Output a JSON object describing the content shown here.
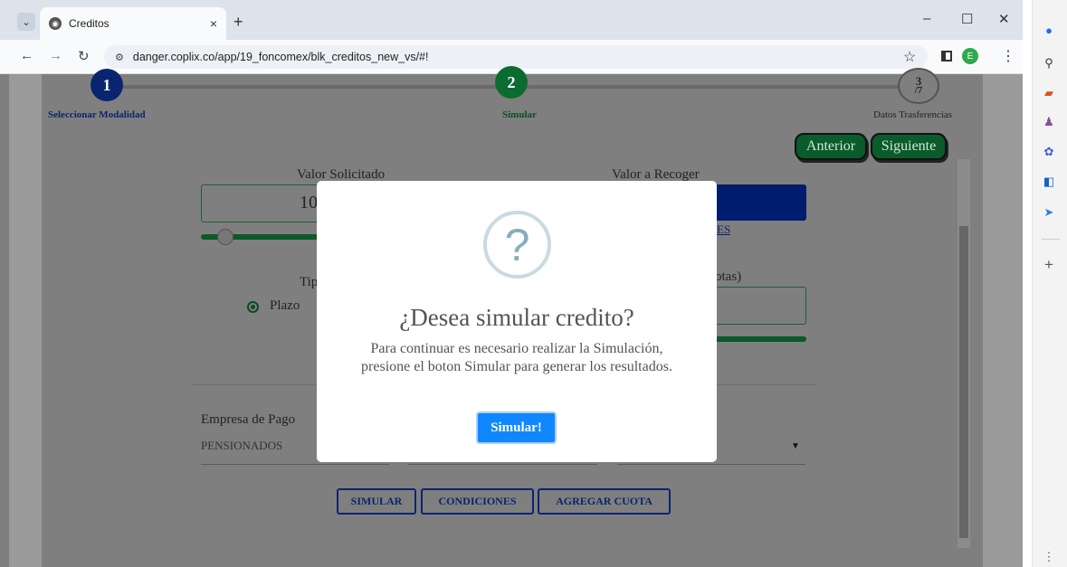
{
  "browser": {
    "tab_title": "Creditos",
    "tab_close": "×",
    "new_tab": "+",
    "url": "danger.coplix.co/app/19_foncomex/blk_creditos_new_vs/#!",
    "profile_initial": "E",
    "window_controls": {
      "minimize": "–",
      "maximize": "☐",
      "close": "✕"
    }
  },
  "wizard": {
    "steps": [
      {
        "number": "1",
        "label": "Seleccionar Modalidad"
      },
      {
        "number": "2",
        "label": "Simular"
      },
      {
        "number": "3",
        "total": "/7",
        "label": "Datos Trasferencias"
      }
    ],
    "prev_label": "Anterior",
    "next_label": "Siguiente"
  },
  "form": {
    "valor_solicitado_label": "Valor Solicitado",
    "valor_solicitado_value": "10",
    "valor_recoger_label": "Valor a Recoger",
    "link_partial": "ES",
    "tipo_label": "Tip",
    "cuotas_label": "otas)",
    "plazo_label": "Plazo",
    "empresa_label": "Empresa de Pago",
    "empresa_value": "PENSIONADOS"
  },
  "actions": {
    "simular": "SIMULAR",
    "condiciones": "CONDICIONES",
    "agregar_cuota": "AGREGAR CUOTA"
  },
  "modal": {
    "icon": "?",
    "title": "¿Desea simular credito?",
    "text": "Para continuar es necesario realizar la Simulación, presione el boton Simular para generar los resultados.",
    "button": "Simular!"
  },
  "colors": {
    "primary_blue": "#0a2570",
    "primary_green": "#0c6b30",
    "modal_button": "#1087ff"
  }
}
